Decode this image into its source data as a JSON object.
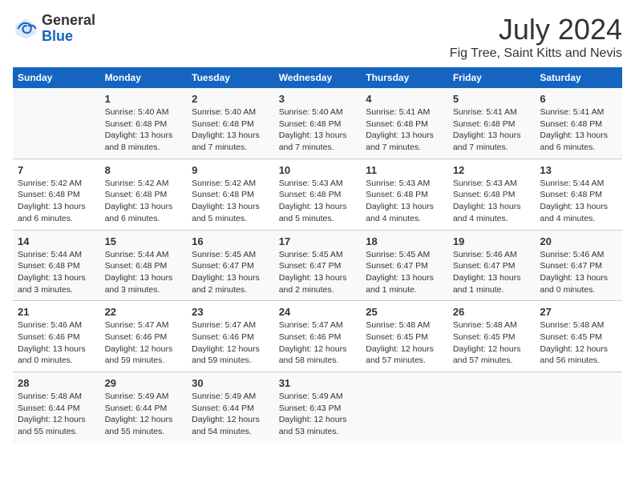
{
  "header": {
    "logo_general": "General",
    "logo_blue": "Blue",
    "month_year": "July 2024",
    "location": "Fig Tree, Saint Kitts and Nevis"
  },
  "days_of_week": [
    "Sunday",
    "Monday",
    "Tuesday",
    "Wednesday",
    "Thursday",
    "Friday",
    "Saturday"
  ],
  "weeks": [
    [
      {
        "day": "",
        "sunrise": "",
        "sunset": "",
        "daylight": ""
      },
      {
        "day": "1",
        "sunrise": "5:40 AM",
        "sunset": "6:48 PM",
        "daylight": "13 hours and 8 minutes."
      },
      {
        "day": "2",
        "sunrise": "5:40 AM",
        "sunset": "6:48 PM",
        "daylight": "13 hours and 7 minutes."
      },
      {
        "day": "3",
        "sunrise": "5:40 AM",
        "sunset": "6:48 PM",
        "daylight": "13 hours and 7 minutes."
      },
      {
        "day": "4",
        "sunrise": "5:41 AM",
        "sunset": "6:48 PM",
        "daylight": "13 hours and 7 minutes."
      },
      {
        "day": "5",
        "sunrise": "5:41 AM",
        "sunset": "6:48 PM",
        "daylight": "13 hours and 7 minutes."
      },
      {
        "day": "6",
        "sunrise": "5:41 AM",
        "sunset": "6:48 PM",
        "daylight": "13 hours and 6 minutes."
      }
    ],
    [
      {
        "day": "7",
        "sunrise": "5:42 AM",
        "sunset": "6:48 PM",
        "daylight": "13 hours and 6 minutes."
      },
      {
        "day": "8",
        "sunrise": "5:42 AM",
        "sunset": "6:48 PM",
        "daylight": "13 hours and 6 minutes."
      },
      {
        "day": "9",
        "sunrise": "5:42 AM",
        "sunset": "6:48 PM",
        "daylight": "13 hours and 5 minutes."
      },
      {
        "day": "10",
        "sunrise": "5:43 AM",
        "sunset": "6:48 PM",
        "daylight": "13 hours and 5 minutes."
      },
      {
        "day": "11",
        "sunrise": "5:43 AM",
        "sunset": "6:48 PM",
        "daylight": "13 hours and 4 minutes."
      },
      {
        "day": "12",
        "sunrise": "5:43 AM",
        "sunset": "6:48 PM",
        "daylight": "13 hours and 4 minutes."
      },
      {
        "day": "13",
        "sunrise": "5:44 AM",
        "sunset": "6:48 PM",
        "daylight": "13 hours and 4 minutes."
      }
    ],
    [
      {
        "day": "14",
        "sunrise": "5:44 AM",
        "sunset": "6:48 PM",
        "daylight": "13 hours and 3 minutes."
      },
      {
        "day": "15",
        "sunrise": "5:44 AM",
        "sunset": "6:48 PM",
        "daylight": "13 hours and 3 minutes."
      },
      {
        "day": "16",
        "sunrise": "5:45 AM",
        "sunset": "6:47 PM",
        "daylight": "13 hours and 2 minutes."
      },
      {
        "day": "17",
        "sunrise": "5:45 AM",
        "sunset": "6:47 PM",
        "daylight": "13 hours and 2 minutes."
      },
      {
        "day": "18",
        "sunrise": "5:45 AM",
        "sunset": "6:47 PM",
        "daylight": "13 hours and 1 minute."
      },
      {
        "day": "19",
        "sunrise": "5:46 AM",
        "sunset": "6:47 PM",
        "daylight": "13 hours and 1 minute."
      },
      {
        "day": "20",
        "sunrise": "5:46 AM",
        "sunset": "6:47 PM",
        "daylight": "13 hours and 0 minutes."
      }
    ],
    [
      {
        "day": "21",
        "sunrise": "5:46 AM",
        "sunset": "6:46 PM",
        "daylight": "13 hours and 0 minutes."
      },
      {
        "day": "22",
        "sunrise": "5:47 AM",
        "sunset": "6:46 PM",
        "daylight": "12 hours and 59 minutes."
      },
      {
        "day": "23",
        "sunrise": "5:47 AM",
        "sunset": "6:46 PM",
        "daylight": "12 hours and 59 minutes."
      },
      {
        "day": "24",
        "sunrise": "5:47 AM",
        "sunset": "6:46 PM",
        "daylight": "12 hours and 58 minutes."
      },
      {
        "day": "25",
        "sunrise": "5:48 AM",
        "sunset": "6:45 PM",
        "daylight": "12 hours and 57 minutes."
      },
      {
        "day": "26",
        "sunrise": "5:48 AM",
        "sunset": "6:45 PM",
        "daylight": "12 hours and 57 minutes."
      },
      {
        "day": "27",
        "sunrise": "5:48 AM",
        "sunset": "6:45 PM",
        "daylight": "12 hours and 56 minutes."
      }
    ],
    [
      {
        "day": "28",
        "sunrise": "5:48 AM",
        "sunset": "6:44 PM",
        "daylight": "12 hours and 55 minutes."
      },
      {
        "day": "29",
        "sunrise": "5:49 AM",
        "sunset": "6:44 PM",
        "daylight": "12 hours and 55 minutes."
      },
      {
        "day": "30",
        "sunrise": "5:49 AM",
        "sunset": "6:44 PM",
        "daylight": "12 hours and 54 minutes."
      },
      {
        "day": "31",
        "sunrise": "5:49 AM",
        "sunset": "6:43 PM",
        "daylight": "12 hours and 53 minutes."
      },
      {
        "day": "",
        "sunrise": "",
        "sunset": "",
        "daylight": ""
      },
      {
        "day": "",
        "sunrise": "",
        "sunset": "",
        "daylight": ""
      },
      {
        "day": "",
        "sunrise": "",
        "sunset": "",
        "daylight": ""
      }
    ]
  ]
}
